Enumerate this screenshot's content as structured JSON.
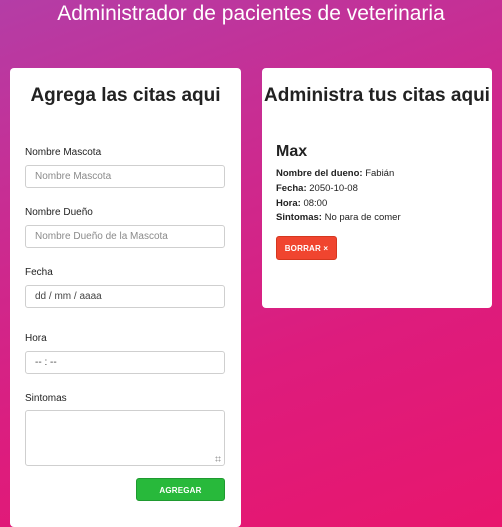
{
  "header": {
    "title": "Administrador de pacientes de veterinaria"
  },
  "form": {
    "title": "Agrega las citas aqui",
    "pet_name_label": "Nombre Mascota",
    "pet_name_placeholder": "Nombre Mascota",
    "owner_label": "Nombre Dueño",
    "owner_placeholder": "Nombre Dueño de la Mascota",
    "date_label": "Fecha",
    "date_value": "dd / mm / aaaa",
    "time_label": "Hora",
    "time_value": "-- : --",
    "symptoms_label": "Sintomas",
    "submit_label": "AGREGAR"
  },
  "appointments": {
    "title": "Administra tus citas aqui",
    "items": [
      {
        "pet": "Max",
        "owner_label": "Nombre del dueno:",
        "owner": "Fabián",
        "date_label": "Fecha:",
        "date": "2050-10-08",
        "time_label": "Hora:",
        "time": "08:00",
        "symptoms_label": "Sintomas:",
        "symptoms": "No para de comer",
        "delete_label": "BORRAR ×"
      }
    ]
  },
  "colors": {
    "gradient_start": "#b43da6",
    "gradient_end": "#e8166d",
    "submit_button": "#28b93b",
    "delete_button": "#f0452f"
  }
}
